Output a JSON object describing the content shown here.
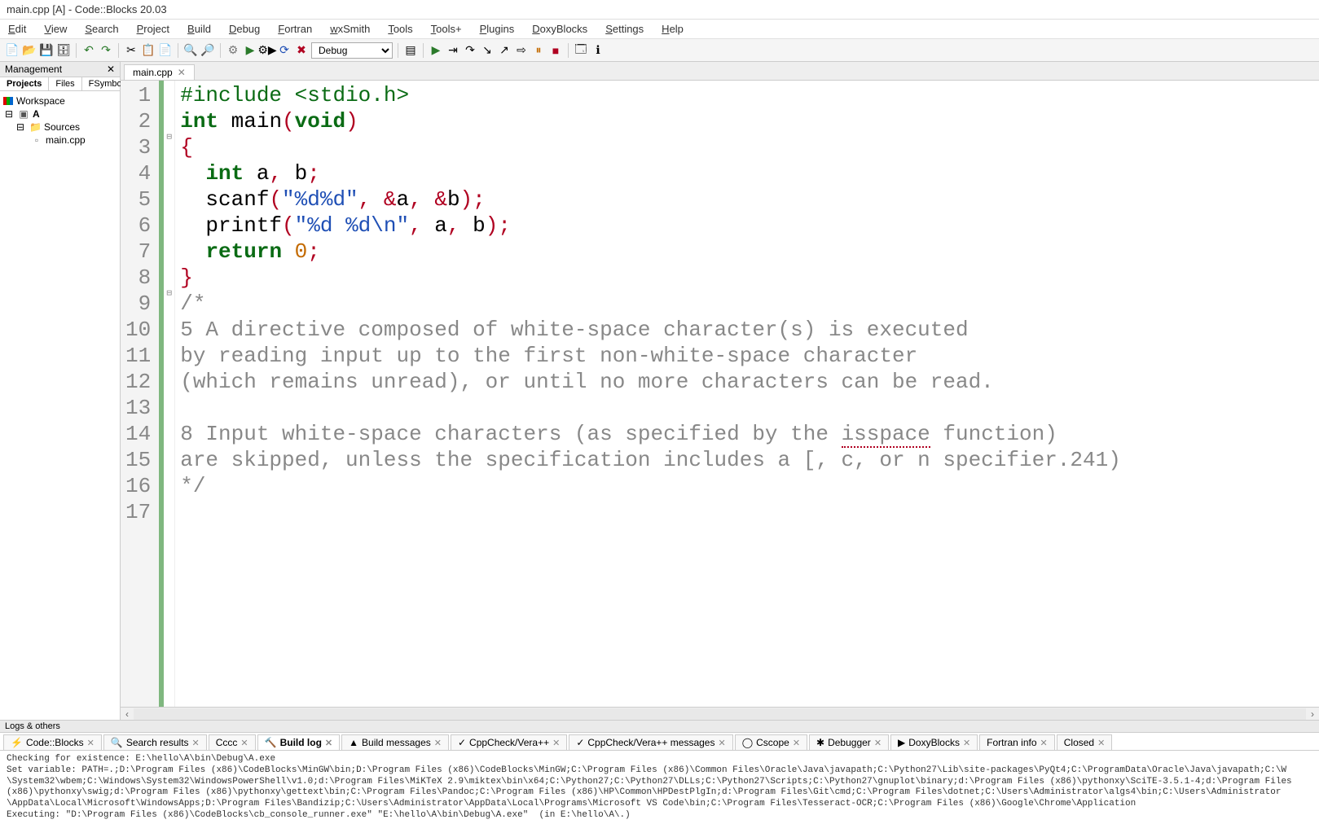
{
  "window": {
    "title": "main.cpp [A] - Code::Blocks 20.03"
  },
  "menu": [
    "Edit",
    "View",
    "Search",
    "Project",
    "Build",
    "Debug",
    "Fortran",
    "wxSmith",
    "Tools",
    "Tools+",
    "Plugins",
    "DoxyBlocks",
    "Settings",
    "Help"
  ],
  "toolbar": {
    "target": "Debug"
  },
  "side": {
    "title": "Management",
    "tabs": [
      "Projects",
      "Files",
      "FSymbols"
    ],
    "workspace": "Workspace",
    "project": "A",
    "folder": "Sources",
    "file": "main.cpp"
  },
  "tab": {
    "name": "main.cpp"
  },
  "code": {
    "lines": [
      {
        "n": "1",
        "segs": [
          {
            "c": "pre",
            "t": "#include "
          },
          {
            "c": "pre",
            "t": "<stdio.h>"
          }
        ]
      },
      {
        "n": "2",
        "segs": [
          {
            "c": "kw",
            "t": "int"
          },
          {
            "c": "",
            "t": " main"
          },
          {
            "c": "paren",
            "t": "("
          },
          {
            "c": "kw",
            "t": "void"
          },
          {
            "c": "paren",
            "t": ")"
          }
        ]
      },
      {
        "n": "3",
        "segs": [
          {
            "c": "paren",
            "t": "{"
          }
        ],
        "fold": "⊟"
      },
      {
        "n": "4",
        "segs": [
          {
            "c": "",
            "t": "  "
          },
          {
            "c": "kw",
            "t": "int"
          },
          {
            "c": "",
            "t": " a"
          },
          {
            "c": "op",
            "t": ","
          },
          {
            "c": "",
            "t": " b"
          },
          {
            "c": "op",
            "t": ";"
          }
        ]
      },
      {
        "n": "5",
        "segs": [
          {
            "c": "",
            "t": "  scanf"
          },
          {
            "c": "paren",
            "t": "("
          },
          {
            "c": "str",
            "t": "\"%d%d\""
          },
          {
            "c": "op",
            "t": ","
          },
          {
            "c": "",
            "t": " "
          },
          {
            "c": "op",
            "t": "&"
          },
          {
            "c": "",
            "t": "a"
          },
          {
            "c": "op",
            "t": ","
          },
          {
            "c": "",
            "t": " "
          },
          {
            "c": "op",
            "t": "&"
          },
          {
            "c": "",
            "t": "b"
          },
          {
            "c": "paren",
            "t": ")"
          },
          {
            "c": "op",
            "t": ";"
          }
        ]
      },
      {
        "n": "6",
        "segs": [
          {
            "c": "",
            "t": "  printf"
          },
          {
            "c": "paren",
            "t": "("
          },
          {
            "c": "str",
            "t": "\"%d %d\\n\""
          },
          {
            "c": "op",
            "t": ","
          },
          {
            "c": "",
            "t": " a"
          },
          {
            "c": "op",
            "t": ","
          },
          {
            "c": "",
            "t": " b"
          },
          {
            "c": "paren",
            "t": ")"
          },
          {
            "c": "op",
            "t": ";"
          }
        ]
      },
      {
        "n": "7",
        "segs": [
          {
            "c": "",
            "t": "  "
          },
          {
            "c": "kw",
            "t": "return"
          },
          {
            "c": "",
            "t": " "
          },
          {
            "c": "num",
            "t": "0"
          },
          {
            "c": "op",
            "t": ";"
          }
        ]
      },
      {
        "n": "8",
        "segs": [
          {
            "c": "paren",
            "t": "}"
          }
        ]
      },
      {
        "n": "9",
        "segs": [
          {
            "c": "cmt",
            "t": "/*"
          }
        ],
        "fold": "⊟"
      },
      {
        "n": "10",
        "segs": [
          {
            "c": "cmt",
            "t": "5 A directive composed of white-space character(s) is executed"
          }
        ]
      },
      {
        "n": "11",
        "segs": [
          {
            "c": "cmt",
            "t": "by reading input up to the first non-white-space character"
          }
        ]
      },
      {
        "n": "12",
        "segs": [
          {
            "c": "cmt",
            "t": "(which remains unread), or until no more characters can be read."
          }
        ]
      },
      {
        "n": "13",
        "segs": [
          {
            "c": "cmt",
            "t": ""
          }
        ]
      },
      {
        "n": "14",
        "segs": [
          {
            "c": "cmt",
            "t": "8 Input white-space characters (as specified by the "
          },
          {
            "c": "cmt underline",
            "t": "isspace"
          },
          {
            "c": "cmt",
            "t": " function)"
          }
        ]
      },
      {
        "n": "15",
        "segs": [
          {
            "c": "cmt",
            "t": "are skipped, unless the specification includes a [, c, or n specifier.241)"
          }
        ]
      },
      {
        "n": "16",
        "segs": [
          {
            "c": "cmt",
            "t": "*/"
          }
        ]
      },
      {
        "n": "17",
        "segs": [
          {
            "c": "",
            "t": ""
          }
        ]
      }
    ]
  },
  "bottom": {
    "title": "Logs & others",
    "tabs": [
      {
        "ico": "⚡",
        "label": "Code::Blocks",
        "active": false
      },
      {
        "ico": "🔍",
        "label": "Search results",
        "active": false
      },
      {
        "ico": "",
        "label": "Cccc",
        "active": false
      },
      {
        "ico": "🔨",
        "label": "Build log",
        "active": true
      },
      {
        "ico": "▲",
        "label": "Build messages",
        "active": false
      },
      {
        "ico": "✓",
        "label": "CppCheck/Vera++",
        "active": false
      },
      {
        "ico": "✓",
        "label": "CppCheck/Vera++ messages",
        "active": false
      },
      {
        "ico": "◯",
        "label": "Cscope",
        "active": false
      },
      {
        "ico": "✱",
        "label": "Debugger",
        "active": false
      },
      {
        "ico": "▶",
        "label": "DoxyBlocks",
        "active": false
      },
      {
        "ico": "",
        "label": "Fortran info",
        "active": false
      },
      {
        "ico": "",
        "label": "Closed",
        "active": false
      }
    ],
    "log": "Checking for existence: E:\\hello\\A\\bin\\Debug\\A.exe\nSet variable: PATH=.;D:\\Program Files (x86)\\CodeBlocks\\MinGW\\bin;D:\\Program Files (x86)\\CodeBlocks\\MinGW;C:\\Program Files (x86)\\Common Files\\Oracle\\Java\\javapath;C:\\Python27\\Lib\\site-packages\\PyQt4;C:\\ProgramData\\Oracle\\Java\\javapath;C:\\W\n\\System32\\wbem;C:\\Windows\\System32\\WindowsPowerShell\\v1.0;d:\\Program Files\\MiKTeX 2.9\\miktex\\bin\\x64;C:\\Python27;C:\\Python27\\DLLs;C:\\Python27\\Scripts;C:\\Python27\\gnuplot\\binary;d:\\Program Files (x86)\\pythonxy\\SciTE-3.5.1-4;d:\\Program Files\n(x86)\\pythonxy\\swig;d:\\Program Files (x86)\\pythonxy\\gettext\\bin;C:\\Program Files\\Pandoc;C:\\Program Files (x86)\\HP\\Common\\HPDestPlgIn;d:\\Program Files\\Git\\cmd;C:\\Program Files\\dotnet;C:\\Users\\Administrator\\algs4\\bin;C:\\Users\\Administrator\n\\AppData\\Local\\Microsoft\\WindowsApps;D:\\Program Files\\Bandizip;C:\\Users\\Administrator\\AppData\\Local\\Programs\\Microsoft VS Code\\bin;C:\\Program Files\\Tesseract-OCR;C:\\Program Files (x86)\\Google\\Chrome\\Application\nExecuting: \"D:\\Program Files (x86)\\CodeBlocks\\cb_console_runner.exe\" \"E:\\hello\\A\\bin\\Debug\\A.exe\"  (in E:\\hello\\A\\.)"
  }
}
